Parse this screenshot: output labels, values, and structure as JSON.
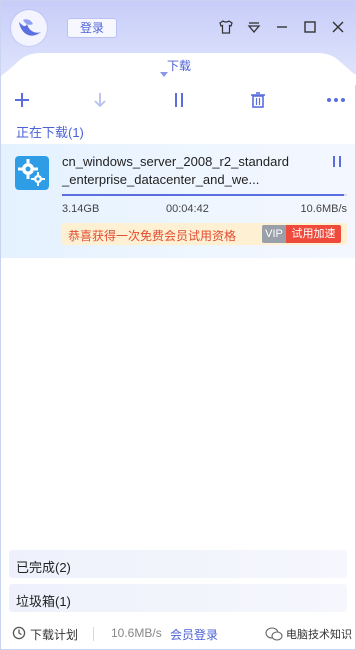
{
  "header": {
    "login_label": "登录"
  },
  "tab": {
    "label": "下载"
  },
  "toolbar": {
    "icons": [
      "plus-icon",
      "download-arrow-icon",
      "pause-icon",
      "trash-icon",
      "more-icon"
    ]
  },
  "downloading": {
    "section_label": "正在下载(1)",
    "item": {
      "filename": "cn_windows_server_2008_r2_standard_enterprise_datacenter_and_we...",
      "size": "3.14GB",
      "remaining_time": "00:04:42",
      "speed": "10.6MB/s",
      "progress": 0.99,
      "promo_text": "恭喜获得一次免费会员试用资格",
      "vip_badge": "VIP",
      "trial_button": "试用加速"
    }
  },
  "completed": {
    "label": "已完成(2)"
  },
  "trash": {
    "label": "垃圾箱(1)"
  },
  "statusbar": {
    "schedule_label": "下载计划",
    "speed": "10.6MB/s",
    "member_login": "会员登录",
    "watermark": "电脑技术知识"
  },
  "colors": {
    "accent": "#4c61d6",
    "header_bg": "#c7cdf8",
    "promo_bg": "#fdf0d3",
    "promo_text": "#e44b2f",
    "trial_bg": "#ef4a3c"
  }
}
